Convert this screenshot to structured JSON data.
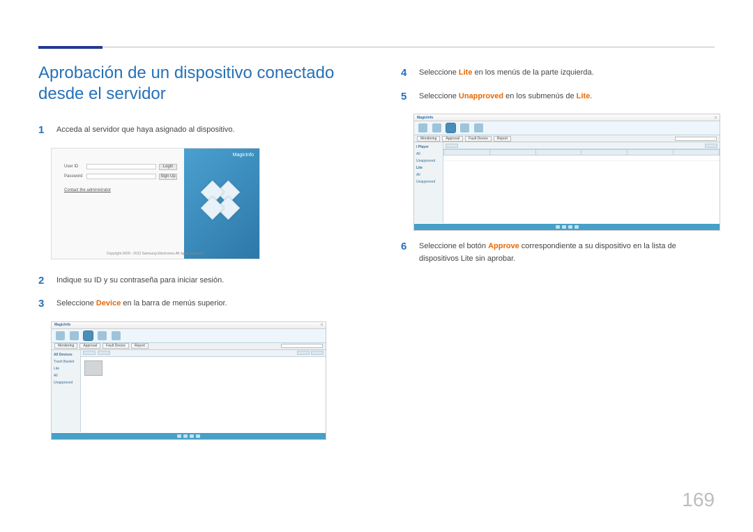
{
  "page_number": "169",
  "heading": "Aprobación de un dispositivo conectado desde el servidor",
  "steps": {
    "s1": {
      "num": "1",
      "text": "Acceda al servidor que haya asignado al dispositivo."
    },
    "s2": {
      "num": "2",
      "text": "Indique su ID y su contraseña para iniciar sesión."
    },
    "s3": {
      "num": "3",
      "pre": "Seleccione ",
      "hl": "Device",
      "post": " en la barra de menús superior."
    },
    "s4": {
      "num": "4",
      "pre": "Seleccione ",
      "hl": "Lite",
      "post": " en los menús de la parte izquierda."
    },
    "s5": {
      "num": "5",
      "pre": "Seleccione ",
      "hl": "Unapproved",
      "post_pre": " en los submenús de ",
      "hl2": "Lite",
      "post": "."
    },
    "s6": {
      "num": "6",
      "pre": "Seleccione el botón ",
      "hl": "Approve",
      "post": " correspondiente a su dispositivo en la lista de dispositivos Lite sin aprobar."
    }
  },
  "login_mock": {
    "user_id_label": "User ID",
    "password_label": "Password",
    "login_btn": "Login",
    "signup_btn": "Sign Up",
    "contact_link": "Contact the administrator",
    "copyright": "Copyright 2009 - 2012 Samsung Electronics All rights reserved.",
    "brand": "MagicInfo"
  },
  "app_mock": {
    "brand": "MagicInfo",
    "sidebar": {
      "group1": "i Player",
      "items1": [
        "All",
        "Unapproved"
      ],
      "group2": "Lite",
      "items2": [
        "All",
        "Unapproved"
      ]
    },
    "sidebar_device": {
      "group": "All Devices",
      "items": [
        "Trash Basket",
        "Lite",
        "All",
        "Unapproved"
      ]
    },
    "tabs": [
      "Monitoring",
      "Approval",
      "Fault Device",
      "Report"
    ]
  }
}
